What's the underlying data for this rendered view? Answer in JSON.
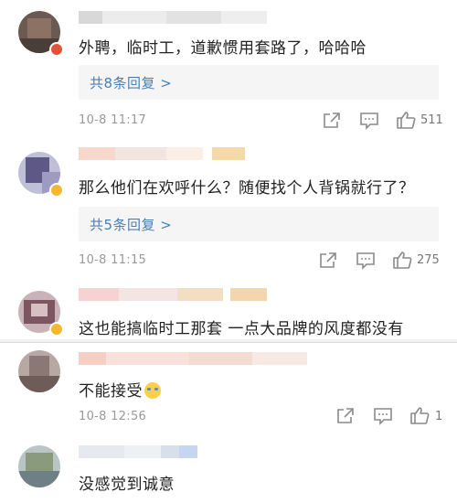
{
  "comments": [
    {
      "text": "外聘，临时工，道歉惯用套路了，哈哈哈",
      "replies_label": "共8条回复 >",
      "timestamp": "10-8 11:17",
      "likes": "511"
    },
    {
      "text": "那么他们在欢呼什么？随便找个人背锅就行了？",
      "replies_label": "共5条回复 >",
      "timestamp": "10-8 11:15",
      "likes": "275"
    },
    {
      "text": "这也能搞临时工那套 一点大品牌的风度都没有"
    },
    {
      "text": "不能接受",
      "emoji": "crying-face-emoji",
      "timestamp": "10-8 12:56",
      "likes": "1"
    },
    {
      "text": "没感觉到诚意"
    }
  ],
  "icons": [
    "share-icon",
    "comment-icon",
    "thumbs-up-icon",
    "crying-face-emoji"
  ],
  "colors": {
    "reply_link": "#4a7fb5",
    "reply_box": "#f5f5f5",
    "meta_text": "#999999",
    "icon_stroke": "#8a8a8a"
  }
}
